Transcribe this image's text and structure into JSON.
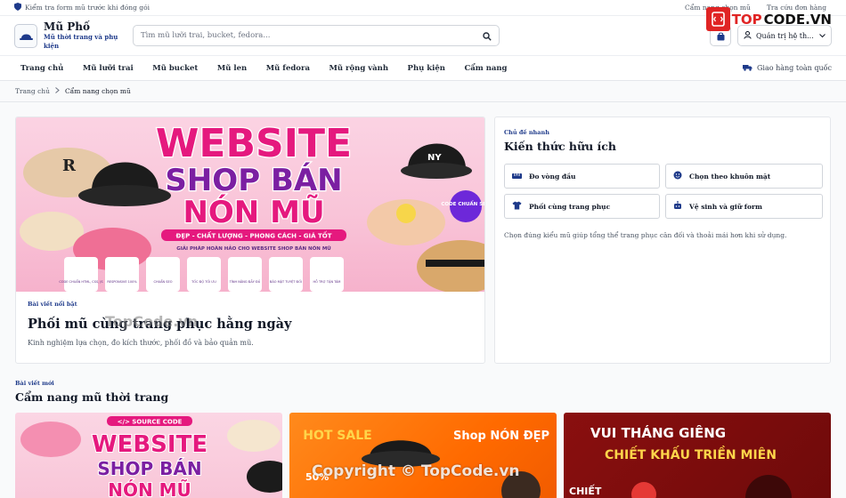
{
  "utility": {
    "notice": "Kiểm tra form mũ trước khi đóng gói",
    "links": [
      "Cẩm nang chọn mũ",
      "Tra cứu đơn hàng"
    ]
  },
  "brand": {
    "name": "Mũ Phố",
    "tagline": "Mũ thời trang và phụ kiện"
  },
  "search": {
    "placeholder": "Tìm mũ lưỡi trai, bucket, fedora...",
    "value": ""
  },
  "account": {
    "label": "Quản trị hệ th..."
  },
  "nav": {
    "items": [
      "Trang chủ",
      "Mũ lưỡi trai",
      "Mũ bucket",
      "Mũ len",
      "Mũ fedora",
      "Mũ rộng vành",
      "Phụ kiện",
      "Cẩm nang"
    ],
    "shipping": "Giao hàng toàn quốc"
  },
  "breadcrumb": {
    "home": "Trang chủ",
    "current": "Cẩm nang chọn mũ"
  },
  "featured": {
    "eyebrow": "Bài viết nổi bật",
    "title": "Phối mũ cùng trang phục hằng ngày",
    "description": "Kinh nghiệm lựa chọn, đo kích thước, phối đồ và bảo quản mũ.",
    "banner": {
      "line1": "WEBSITE",
      "line2": "SHOP BÁN",
      "line3": "NÓN MŨ",
      "ribbon": "ĐẸP - CHẤT LƯỢNG - PHONG CÁCH - GIÁ TỐT",
      "sub": "GIẢI PHÁP HOÀN HẢO CHO WEBSITE SHOP BÁN NÓN MŨ",
      "badge": "CODE CHUẨN SEO",
      "features": [
        "CODE CHUẨN HTML, CSS, JS",
        "RESPONSIVE 100%",
        "CHUẨN SEO",
        "TỐC ĐỘ TỐI ƯU",
        "TÍNH NĂNG ĐẦY ĐỦ",
        "BẢO MẬT TUYỆT ĐỐI",
        "HỖ TRỢ TẬN TÂM"
      ]
    }
  },
  "sidebar": {
    "eyebrow": "Chủ đề nhanh",
    "title": "Kiến thức hữu ích",
    "topics": [
      "Đo vòng đầu",
      "Chọn theo khuôn mặt",
      "Phối cùng trang phục",
      "Vệ sinh và giữ form"
    ],
    "note": "Chọn đúng kiểu mũ giúp tổng thể trang phục cân đối và thoải mái hơn khi sử dụng."
  },
  "section": {
    "eyebrow": "Bài viết mới",
    "title": "Cẩm nang mũ thời trang"
  },
  "cards": [
    {
      "tag": "</> SOURCE CODE",
      "line1": "WEBSITE",
      "line2": "SHOP BÁN",
      "line3": "NÓN MŨ"
    },
    {
      "tag": "HOT SALE",
      "line1": "Shop NÓN ĐẸP",
      "line2": "50%"
    },
    {
      "tag": "VUI THÁNG GIÊNG",
      "line1": "CHIẾT KHẤU TRIỀN MIÊN",
      "line2": "CHIẾT"
    }
  ],
  "watermarks": {
    "logo_top": "TOP",
    "logo_rest": "CODE.VN",
    "center": "TopCode.vn",
    "bottom": "Copyright © TopCode.vn"
  },
  "colors": {
    "accent": "#1e3a8a",
    "banner_pink": "#f9c4d8",
    "banner_magenta": "#e5197e",
    "banner_purple": "#7b1fa2",
    "watermark_red": "#e02424"
  }
}
